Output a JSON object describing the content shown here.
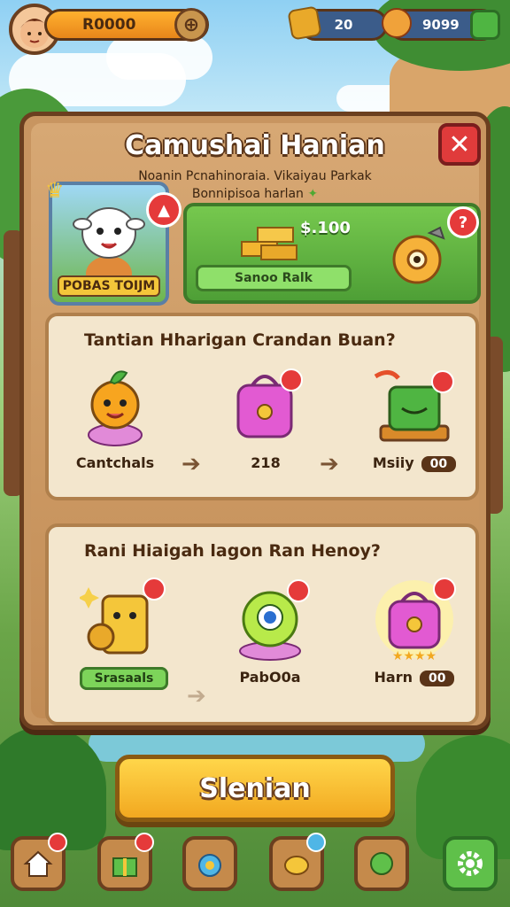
{
  "top_bar": {
    "coins": "R0000",
    "resource_1": "20",
    "resource_2": "9099"
  },
  "panel": {
    "title": "Camushai Hanian",
    "subtitle_line1": "Noanin Pcnahinoraia. Vikaiyau Parkak",
    "subtitle_line2": "Bonnipisoa harlan",
    "character_label": "POBAS TOIJM",
    "reward_amount": "$.100",
    "reward_button": "Sanoo Ralk"
  },
  "section_1": {
    "title": "Tantian Hharigan Crandan Buan?",
    "items": [
      {
        "label": "Cantchals"
      },
      {
        "label": "218"
      },
      {
        "label": "Msiiy",
        "badge": "00"
      }
    ]
  },
  "section_2": {
    "title": "Rani Hiaigah lagon Ran Henoy?",
    "items": [
      {
        "label": "Srasaals"
      },
      {
        "label": "PabO0a"
      },
      {
        "label": "Harn",
        "badge": "00"
      }
    ]
  },
  "cta": {
    "label": "Slenian"
  },
  "colors": {
    "accent": "#f2a820",
    "panel": "#c89560",
    "reward": "#4e9f36",
    "close": "#e03b3b"
  },
  "icons": [
    "home-icon",
    "gift-icon",
    "medal-icon",
    "food-icon",
    "leaf-icon",
    "settings-icon"
  ]
}
